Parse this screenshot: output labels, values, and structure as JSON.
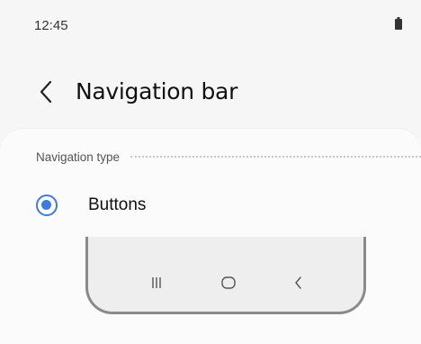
{
  "status_bar": {
    "time": "12:45"
  },
  "header": {
    "title": "Navigation bar"
  },
  "section": {
    "label": "Navigation type"
  },
  "option": {
    "label": "Buttons",
    "selected": true
  },
  "colors": {
    "accent": "#3e7ae0",
    "background": "#f6f6f6",
    "card": "#fbfbfb"
  },
  "icons": {
    "battery": "battery-icon",
    "back": "chevron-left-icon",
    "recents": "recents-icon",
    "home": "home-icon",
    "nav_back": "back-icon"
  }
}
